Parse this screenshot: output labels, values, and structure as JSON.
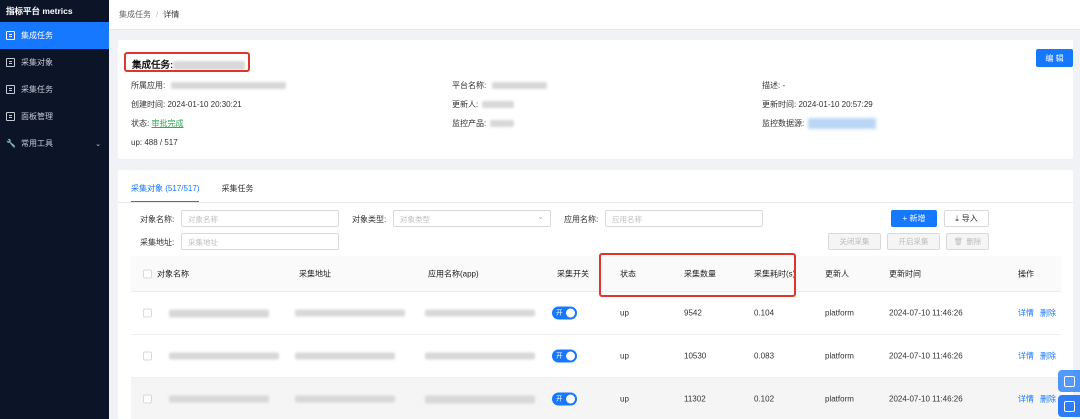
{
  "sidebar": {
    "title": "指标平台 metrics",
    "items": [
      {
        "label": "集成任务",
        "icon": "document-icon",
        "active": true
      },
      {
        "label": "采集对象",
        "icon": "grid-icon"
      },
      {
        "label": "采集任务",
        "icon": "grid-icon"
      },
      {
        "label": "面板管理",
        "icon": "panel-icon"
      },
      {
        "label": "常用工具",
        "icon": "wrench-icon",
        "has_children": true
      }
    ]
  },
  "breadcrumb": {
    "root": "集成任务",
    "sep": "/",
    "current": "详情"
  },
  "info": {
    "title": "集成任务:",
    "edit_label": "编 辑",
    "app_label": "所属应用:",
    "platform_label": "平台名称:",
    "desc_label": "描述:",
    "desc_value": "-",
    "created_label": "创建时间:",
    "created_value": "2024-01-10 20:30:21",
    "updater_label": "更新人:",
    "updated_label": "更新时间:",
    "updated_value": "2024-01-10 20:57:29",
    "status_label": "状态:",
    "status_value": "审批完成",
    "product_label": "监控产品:",
    "datasource_label": "监控数据源:",
    "up_value": "up: 488 / 517"
  },
  "tabs": [
    "采集对象 (517/517)",
    "采集任务"
  ],
  "filters": {
    "object_name_label": "对象名称:",
    "object_name_placeholder": "对象名称",
    "object_type_label": "对象类型:",
    "object_type_placeholder": "对象类型",
    "app_name_label": "应用名称:",
    "app_name_placeholder": "应用名称",
    "address_label": "采集地址:",
    "address_placeholder": "采集地址"
  },
  "actions": {
    "add": "+ 新增",
    "import": "导入",
    "close_collect": "关闭采集",
    "open_collect": "开启采集",
    "delete": "删除"
  },
  "table": {
    "headers": [
      "对象名称",
      "采集地址",
      "应用名称(app)",
      "采集开关",
      "状态",
      "采集数量",
      "采集耗时(s)",
      "更新人",
      "更新时间",
      "操作"
    ],
    "switch_label": "开",
    "detail_label": "详情",
    "delete_label": "删除",
    "rows": [
      {
        "status": "up",
        "count": "9542",
        "duration": "0.104",
        "updater": "platform",
        "time": "2024-07-10 11:46:26"
      },
      {
        "status": "up",
        "count": "10530",
        "duration": "0.083",
        "updater": "platform",
        "time": "2024-07-10 11:46:26"
      },
      {
        "status": "up",
        "count": "11302",
        "duration": "0.102",
        "updater": "platform",
        "time": "2024-07-10 11:46:26"
      }
    ]
  },
  "colors": {
    "primary": "#1677ff",
    "sidebar_bg": "#0c1528",
    "highlight": "#e0342c",
    "success": "#34a853"
  }
}
